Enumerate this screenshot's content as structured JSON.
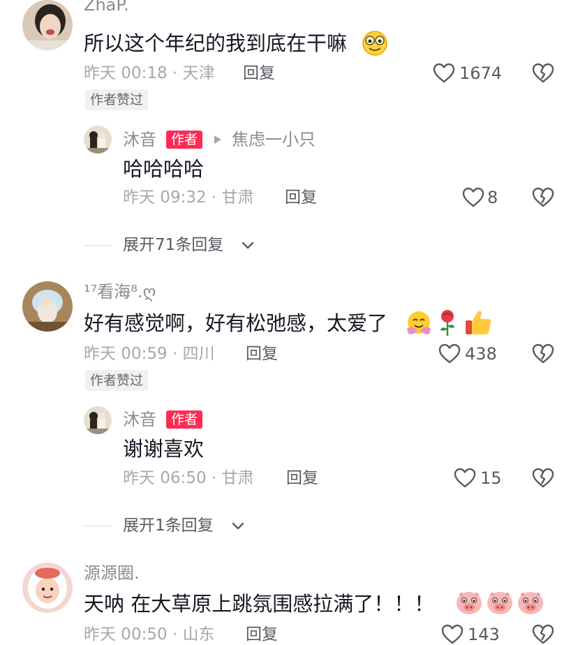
{
  "comments": [
    {
      "username": "ZhaP.",
      "text": "所以这个年纪的我到底在干嘛",
      "time": "昨天 00:18",
      "location": "· 天津",
      "reply_label": "回复",
      "likes": "1674",
      "liked_tag": "作者赞过",
      "reply": {
        "username": "沐音",
        "author_tag": "作者",
        "reply_to": "焦虑一小只",
        "text": "哈哈哈哈",
        "time": "昨天 09:32",
        "location": "· 甘肃",
        "reply_label": "回复",
        "likes": "8"
      },
      "expand_label": "展开71条回复"
    },
    {
      "username": "¹⁷看海⁸.ღ",
      "text": "好有感觉啊，好有松弛感，太爱了",
      "time": "昨天 00:59",
      "location": "· 四川",
      "reply_label": "回复",
      "likes": "438",
      "liked_tag": "作者赞过",
      "reply": {
        "username": "沐音",
        "author_tag": "作者",
        "text": "谢谢喜欢",
        "time": "昨天 06:50",
        "location": "· 甘肃",
        "reply_label": "回复",
        "likes": "15"
      },
      "expand_label": "展开1条回复"
    },
    {
      "username": "源源圈.",
      "text": "天呐  在大草原上跳氛围感拉满了！！！",
      "time": "昨天 00:50",
      "location": "· 山东",
      "reply_label": "回复",
      "likes": "143"
    }
  ],
  "icons": {
    "like": "heart-outline-icon",
    "dislike": "broken-heart-icon",
    "expand": "chevron-down-icon",
    "reply_arrow": "play-triangle-icon"
  },
  "colors": {
    "author_tag": "#fe2c55",
    "secondary_text": "#a7a8ac",
    "username": "#8a8b91"
  }
}
